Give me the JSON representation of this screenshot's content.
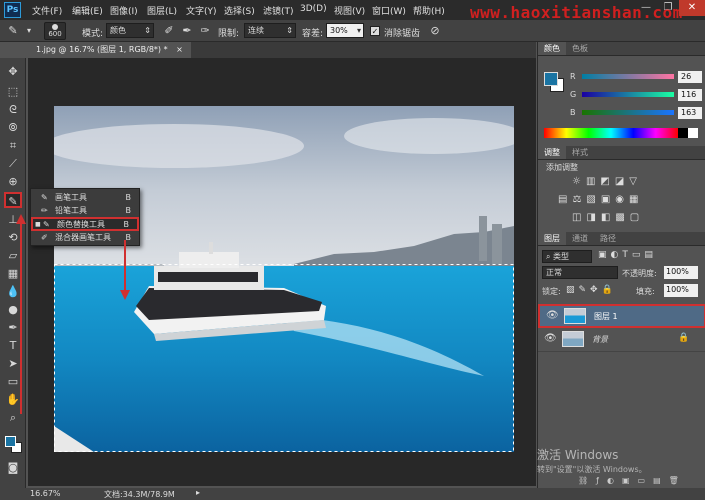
{
  "app": {
    "logo": "Ps",
    "watermark": "www.haoxitianshan.com"
  },
  "menu": [
    "文件(F)",
    "编辑(E)",
    "图像(I)",
    "图层(L)",
    "文字(Y)",
    "选择(S)",
    "滤镜(T)",
    "3D(D)",
    "视图(V)",
    "窗口(W)",
    "帮助(H)"
  ],
  "window_controls": {
    "minimize": "—",
    "restore": "❐",
    "close": "✕"
  },
  "options": {
    "brush_size": "600",
    "mode_label": "模式:",
    "mode_value": "颜色",
    "limit_label": "限制:",
    "limit_value": "连续",
    "tolerance_label": "容差:",
    "tolerance_value": "30%",
    "antialias_label": "消除锯齿"
  },
  "document": {
    "tab_title": "1.jpg @ 16.7% (图层 1, RGB/8*) *",
    "close": "×"
  },
  "flyout": [
    {
      "label": "画笔工具",
      "key": "B",
      "selected": false
    },
    {
      "label": "铅笔工具",
      "key": "B",
      "selected": false
    },
    {
      "label": "颜色替换工具",
      "key": "B",
      "selected": true
    },
    {
      "label": "混合器画笔工具",
      "key": "B",
      "selected": false
    }
  ],
  "color_panel": {
    "tabs": [
      "颜色",
      "色板"
    ],
    "r_label": "R",
    "r_value": "26",
    "g_label": "G",
    "g_value": "116",
    "b_label": "B",
    "b_value": "163",
    "fg_color": "#1a74a3"
  },
  "adjustments_panel": {
    "tabs": [
      "调整",
      "样式"
    ],
    "title": "添加调整"
  },
  "layers_panel": {
    "tabs": [
      "图层",
      "通道",
      "路径"
    ],
    "kind_label": "类型",
    "blend_mode": "正常",
    "opacity_label": "不透明度:",
    "opacity_value": "100%",
    "lock_label": "锁定:",
    "fill_label": "填充:",
    "fill_value": "100%",
    "layers": [
      {
        "name": "图层 1",
        "selected": true
      },
      {
        "name": "背景",
        "selected": false
      }
    ]
  },
  "status": {
    "zoom": "16.67%",
    "doc": "文档:34.3M/78.9M"
  },
  "windows_activation": {
    "title": "激活 Windows",
    "subtitle": "转到\"设置\"以激活 Windows。"
  }
}
